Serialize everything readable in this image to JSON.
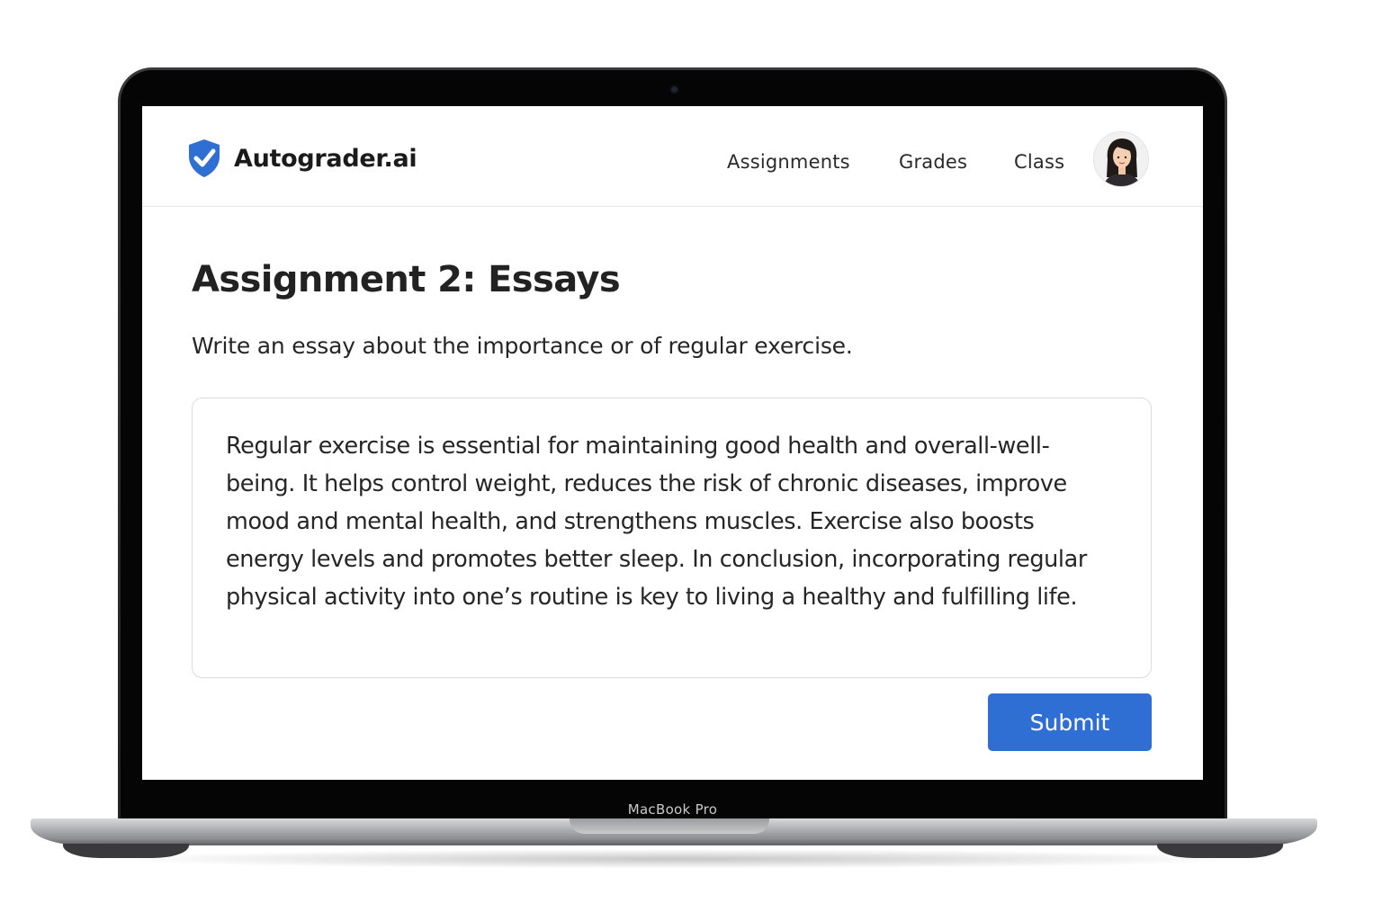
{
  "app": {
    "name": "Autograder.ai",
    "logo_icon": "shield-check-icon",
    "brand_color": "#2f6fd3"
  },
  "nav": {
    "items": [
      {
        "label": "Assignments"
      },
      {
        "label": "Grades"
      },
      {
        "label": "Class"
      }
    ],
    "avatar_icon": "user-avatar-icon"
  },
  "assignment": {
    "title": "Assignment 2: Essays",
    "prompt": "Write an essay about the importance or of regular exercise.",
    "essay_text": "Regular exercise is essential for maintaining good health and overall-well-being. It helps control weight, reduces the risk of chronic diseases, improve mood and mental health, and strengthens muscles. Exercise also boosts energy levels and promotes better sleep. In conclusion, incorporating regular physical activity into one’s routine is key to living a healthy and fulfilling life.",
    "submit_label": "Submit"
  },
  "device": {
    "label": "MacBook Pro"
  }
}
